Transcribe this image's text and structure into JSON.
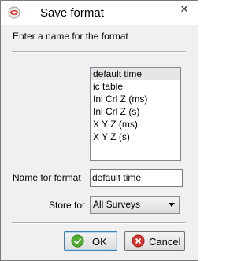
{
  "window": {
    "title": "Save format",
    "close_glyph": "✕",
    "app_icon": "app-icon"
  },
  "prompt": "Enter a name for the format",
  "formats": {
    "items": [
      "default time",
      "ic table",
      "Inl Crl Z (ms)",
      "Inl Crl Z (s)",
      "X Y Z (ms)",
      "X Y Z (s)"
    ],
    "selected": "default time"
  },
  "name_field": {
    "label": "Name for format",
    "value": "default time"
  },
  "store_for": {
    "label": "Store for",
    "value": "All Surveys"
  },
  "buttons": {
    "ok_label": "OK",
    "ok_icon": "check-icon",
    "cancel_label": "Cancel",
    "cancel_icon": "cancel-icon"
  },
  "colors": {
    "ok_icon_green": "#4caf2c",
    "cancel_icon_red": "#d9342b"
  }
}
